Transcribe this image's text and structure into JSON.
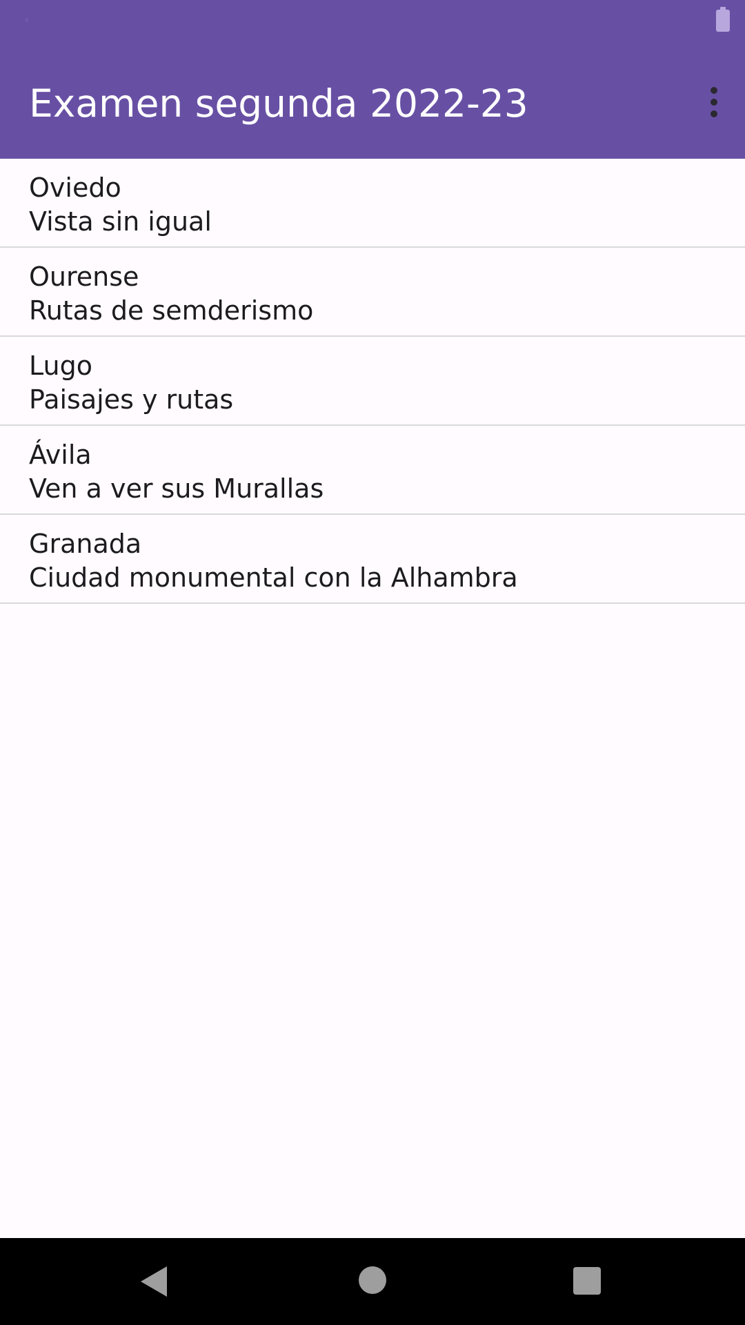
{
  "app": {
    "title": "Examen segunda 2022-23",
    "accent_color": "#6750A4",
    "overflow_icon": "more-vert-icon"
  },
  "status_bar": {
    "battery_icon": "battery-icon"
  },
  "list": {
    "items": [
      {
        "title": "Oviedo",
        "subtitle": "Vista sin igual"
      },
      {
        "title": "Ourense",
        "subtitle": "Rutas de semderismo"
      },
      {
        "title": "Lugo",
        "subtitle": "Paisajes y rutas"
      },
      {
        "title": "Ávila",
        "subtitle": "Ven a ver sus Murallas"
      },
      {
        "title": "Granada",
        "subtitle": "Ciudad monumental con la Alhambra"
      }
    ]
  },
  "navigation_bar": {
    "back_icon": "back-icon",
    "home_icon": "home-icon",
    "recents_icon": "recents-icon"
  }
}
